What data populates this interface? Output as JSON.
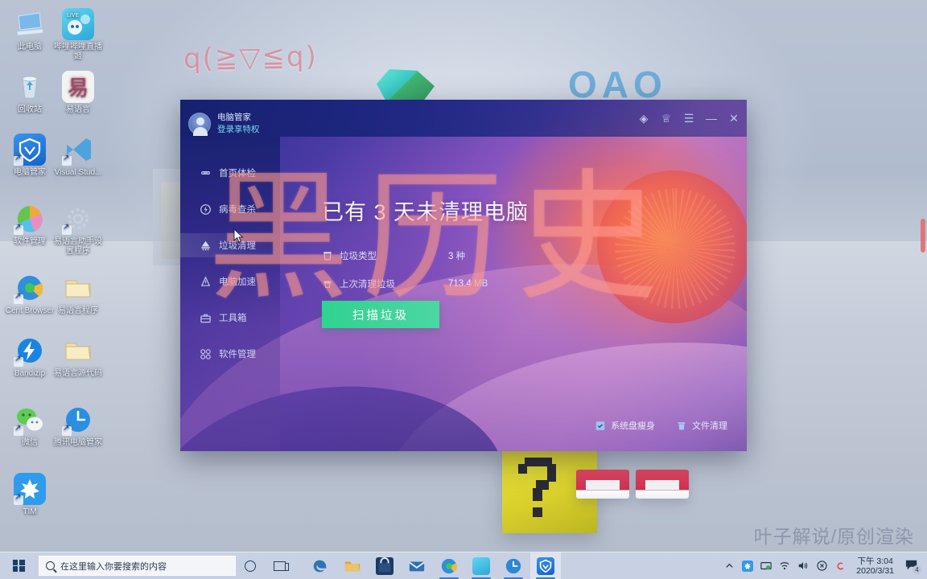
{
  "desktop": {
    "decor_kaomoji": "q(≧▽≦q)",
    "decor_oao": "OAO",
    "watermark": "叶子解说/原创渲染",
    "icons": [
      {
        "label": "此电脑",
        "icon": "monitor-icon",
        "color": "#6fb0e8",
        "shortcut": false
      },
      {
        "label": "哔哩哔哩直播姬",
        "icon": "bilibili-live-icon",
        "color": "#32b7e8",
        "shortcut": false
      },
      {
        "label": "回收站",
        "icon": "recycle-bin-icon",
        "color": "#c3d3df",
        "shortcut": false
      },
      {
        "label": "易语言",
        "icon": "epl-icon",
        "color": "#f0f0f0",
        "shortcut": false
      },
      {
        "label": "电脑管家",
        "icon": "pc-manager-icon",
        "color": "#2a7fe0",
        "shortcut": true
      },
      {
        "label": "Visual Stud...",
        "icon": "visual-studio-icon",
        "color": "#5fa8dd",
        "shortcut": true
      },
      {
        "label": "软件管理",
        "icon": "software-manager-icon",
        "color": "#f2a63a",
        "shortcut": true
      },
      {
        "label": "易语言助手设置程序",
        "icon": "gear-icon",
        "color": "#c9d2de",
        "shortcut": true
      },
      {
        "label": "Cent Browser",
        "icon": "cent-browser-icon",
        "color": "#2f7fd6",
        "shortcut": true
      },
      {
        "label": "易语言程序",
        "icon": "folder-icon",
        "color": "#f2dfa4",
        "shortcut": false
      },
      {
        "label": "Bandizip",
        "icon": "bandizip-icon",
        "color": "#1b85e0",
        "shortcut": true
      },
      {
        "label": "易语言源代码",
        "icon": "folder-icon",
        "color": "#f2dfa4",
        "shortcut": false
      },
      {
        "label": "微信",
        "icon": "wechat-icon",
        "color": "#4ec94e",
        "shortcut": true
      },
      {
        "label": "腾讯电脑管家",
        "icon": "tencent-pc-manager-icon",
        "color": "#2a8fe0",
        "shortcut": true
      },
      {
        "label": "TIM",
        "icon": "tim-icon",
        "color": "#2a9bec",
        "shortcut": true
      }
    ]
  },
  "taskbar": {
    "search_placeholder": "在这里输入你要搜索的内容",
    "start_name": "start-button",
    "apps": [
      {
        "name": "edge",
        "color": "#2e74b5"
      },
      {
        "name": "file-explorer",
        "color": "#d9a02c"
      },
      {
        "name": "microsoft-store",
        "color": "#1b3a63"
      },
      {
        "name": "mail",
        "color": "#2f6fb8"
      },
      {
        "name": "cent-browser",
        "color": "#2f7fd6"
      },
      {
        "name": "bilibili-live",
        "color": "#49b9e8"
      },
      {
        "name": "tencent-clock",
        "color": "#2d86d6"
      },
      {
        "name": "pc-manager",
        "color": "#2a7fe0",
        "active": true
      }
    ],
    "tray": [
      "chevron-up-icon",
      "tim-icon",
      "screen-icon",
      "wifi-icon",
      "volume-icon",
      "action-x-icon",
      "sogou-icon"
    ],
    "clock_time": "下午 3:04",
    "clock_date": "2020/3/31",
    "notification_count": "4"
  },
  "pcmgr": {
    "account": {
      "name": "电脑管家",
      "subtitle": "登录享特权"
    },
    "titlebar_controls": [
      {
        "name": "feedback-leaf-icon",
        "glyph": "◈"
      },
      {
        "name": "skin-shirt-icon",
        "glyph": "♕"
      },
      {
        "name": "menu-icon",
        "glyph": "☰"
      },
      {
        "name": "minimize-icon",
        "glyph": "—"
      },
      {
        "name": "close-icon",
        "glyph": "✕"
      }
    ],
    "nav": [
      {
        "label": "首页体检",
        "icon": "home-checkup-icon"
      },
      {
        "label": "病毒查杀",
        "icon": "virus-scan-icon"
      },
      {
        "label": "垃圾清理",
        "icon": "junk-cleanup-icon",
        "selected": true
      },
      {
        "label": "电脑加速",
        "icon": "speedup-icon"
      },
      {
        "label": "工具箱",
        "icon": "toolbox-icon"
      },
      {
        "label": "软件管理",
        "icon": "software-manage-icon"
      }
    ],
    "headline": "已有 3 天未清理电脑",
    "stats": [
      {
        "label": "垃圾类型",
        "value": "3",
        "unit": "种",
        "icon": "trash-type-icon"
      },
      {
        "label": "上次清理垃圾",
        "value": "713.4",
        "unit": "MB",
        "icon": "last-clean-icon"
      }
    ],
    "scan_button": "扫描垃圾",
    "bottom_links": [
      {
        "label": "系统盘瘦身",
        "icon": "disk-slim-icon"
      },
      {
        "label": "文件清理",
        "icon": "file-clean-icon"
      }
    ],
    "accent_green": "#3fd39a",
    "accent_cyan": "#7fd8ef"
  },
  "overlay": {
    "text": "黑历史",
    "color": "#ff968c"
  }
}
